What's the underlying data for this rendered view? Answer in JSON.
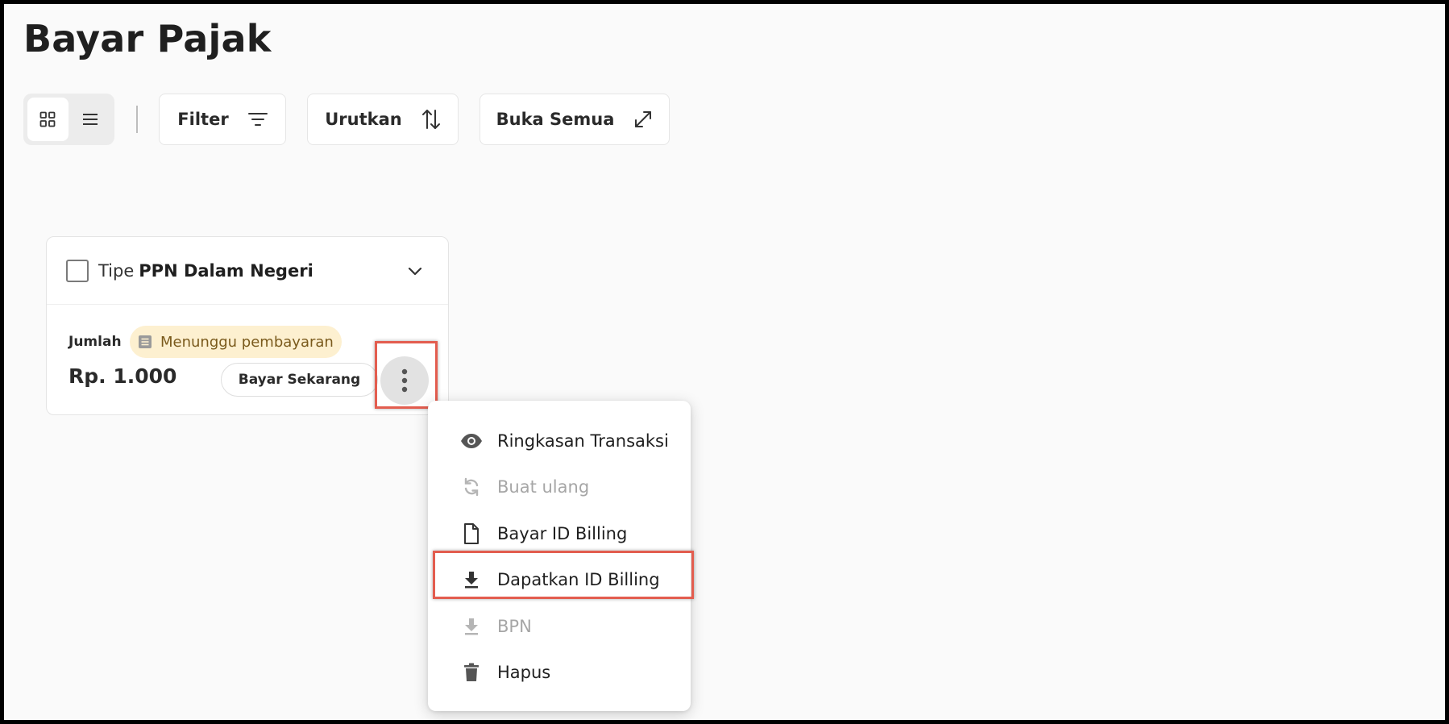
{
  "page": {
    "title": "Bayar Pajak"
  },
  "toolbar": {
    "filter_label": "Filter",
    "sort_label": "Urutkan",
    "expand_label": "Buka Semua"
  },
  "card": {
    "type_prefix": "Tipe",
    "type_value": "PPN Dalam Negeri",
    "amount_label": "Jumlah",
    "status_text": "Menunggu pembayaran",
    "amount_value": "Rp. 1.000",
    "pay_button_label": "Bayar Sekarang"
  },
  "menu": {
    "items": [
      {
        "label": "Ringkasan Transaksi",
        "icon": "eye-icon",
        "disabled": false
      },
      {
        "label": "Buat ulang",
        "icon": "refresh-icon",
        "disabled": true
      },
      {
        "label": "Bayar ID Billing",
        "icon": "document-icon",
        "disabled": false
      },
      {
        "label": "Dapatkan ID Billing",
        "icon": "download-icon",
        "disabled": false
      },
      {
        "label": "BPN",
        "icon": "download-icon",
        "disabled": true
      },
      {
        "label": "Hapus",
        "icon": "trash-icon",
        "disabled": false
      }
    ]
  },
  "colors": {
    "highlight": "#e35d4f",
    "status_bg": "#fdf0d0",
    "status_text": "#7a5a1c"
  }
}
